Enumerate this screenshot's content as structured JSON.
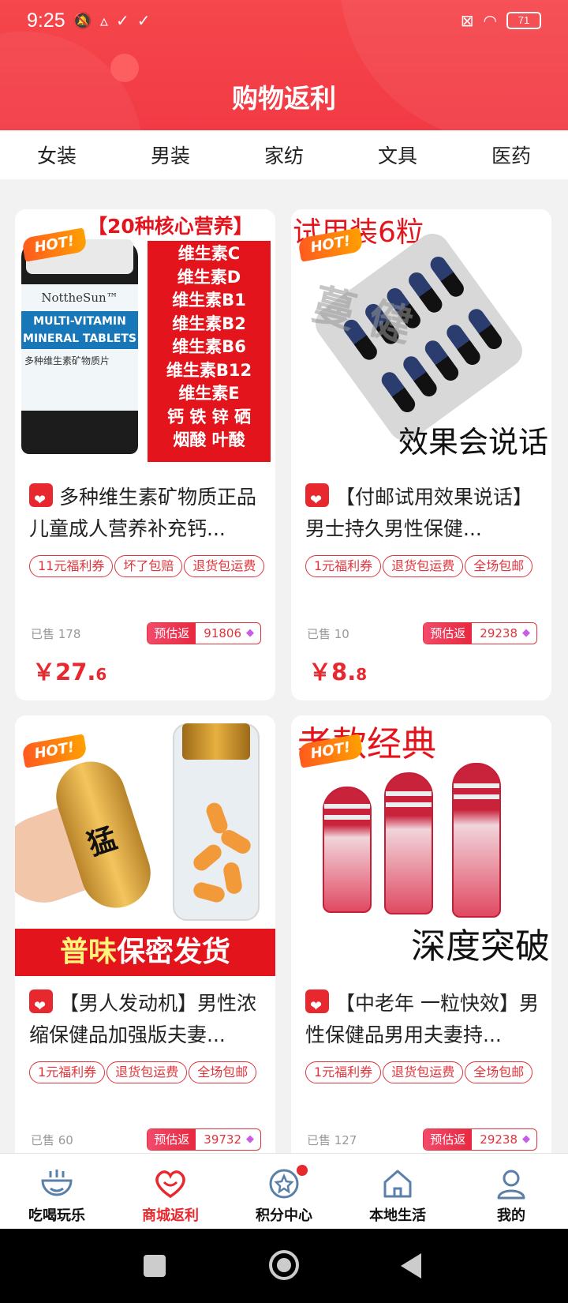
{
  "status": {
    "time": "9:25",
    "battery": "71"
  },
  "header": {
    "title": "购物返利"
  },
  "category_tabs": [
    "女装",
    "男装",
    "家纺",
    "文具",
    "医药"
  ],
  "products": [
    {
      "title": "多种维生素矿物质正品儿童成人营养补充钙...",
      "tags": [
        "11元福利券",
        "坏了包赔",
        "退货包运费"
      ],
      "sold": "已售 178",
      "rebate_label": "预估返",
      "rebate_value": "91806",
      "price_symbol": "￥",
      "price_int": "27.",
      "price_dec": "6",
      "image": {
        "hot": "HOT!",
        "headline": "【20种核心营养】",
        "brand": "NottheSun™",
        "band": "MULTI-VITAMIN MINERAL TABLETS",
        "cn": "多种维生素矿物质片",
        "list": [
          "维生素C",
          "维生素D",
          "维生素B1",
          "维生素B2",
          "维生素B6",
          "维生素B12",
          "维生素E",
          "钙 铁 锌 硒",
          "烟酸 叶酸"
        ]
      }
    },
    {
      "title": "【付邮试用效果说话】男士持久男性保健...",
      "tags": [
        "1元福利券",
        "退货包运费",
        "全场包邮"
      ],
      "sold": "已售 10",
      "rebate_label": "预估返",
      "rebate_value": "29238",
      "price_symbol": "￥",
      "price_int": "8.",
      "price_dec": "8",
      "image": {
        "hot": "HOT!",
        "headline": "试用装6粒",
        "watermark": "蔓 健",
        "footer": "效果会说话"
      }
    },
    {
      "title": "【男人发动机】男性浓缩保健品加强版夫妻...",
      "tags": [
        "1元福利券",
        "退货包运费",
        "全场包邮"
      ],
      "sold": "已售 60",
      "rebate_label": "预估返",
      "rebate_value": "39732",
      "image": {
        "hot": "HOT!",
        "capsule_text": "猛",
        "banner_a": "普味",
        "banner_b": "保密发货"
      }
    },
    {
      "title": "【中老年 一粒快效】男性保健品男用夫妻持...",
      "tags": [
        "1元福利券",
        "退货包运费",
        "全场包邮"
      ],
      "sold": "已售 127",
      "rebate_label": "预估返",
      "rebate_value": "29238",
      "image": {
        "hot": "HOT!",
        "headline": "老款经典",
        "footer": "深度突破"
      }
    }
  ],
  "bottom_nav": [
    {
      "label": "吃喝玩乐",
      "icon": "bowl-icon"
    },
    {
      "label": "商城返利",
      "icon": "heart-icon"
    },
    {
      "label": "积分中心",
      "icon": "star-badge-icon"
    },
    {
      "label": "本地生活",
      "icon": "home-icon"
    },
    {
      "label": "我的",
      "icon": "user-icon"
    }
  ],
  "colors": {
    "brand_red": "#e8282f",
    "header_red": "#f2424a"
  }
}
